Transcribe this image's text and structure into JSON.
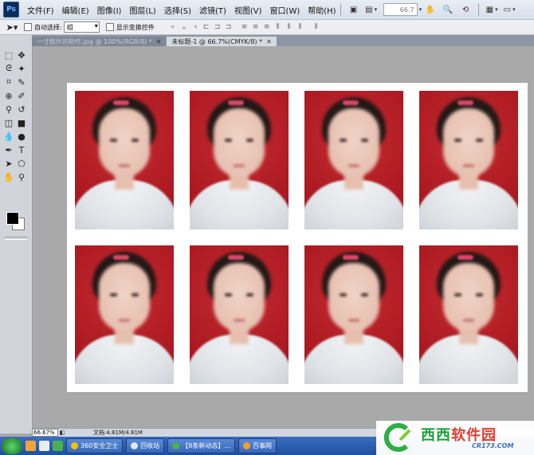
{
  "app": {
    "logo": "Ps"
  },
  "menu": [
    "文件(F)",
    "编辑(E)",
    "图像(I)",
    "图层(L)",
    "选择(S)",
    "滤镜(T)",
    "视图(V)",
    "窗口(W)",
    "帮助(H)"
  ],
  "menubar": {
    "zoom_value": "66.7"
  },
  "options": {
    "auto_select_label": "自动选择:",
    "auto_select_value": "组",
    "show_transform_label": "显示变换控件"
  },
  "tabs": [
    {
      "label": "一寸照片的制作.jpg @ 100%(RGB/8) *"
    },
    {
      "label": "未标题-1 @ 66.7%(CMYK/8) *"
    }
  ],
  "status": {
    "zoom": "66.67%",
    "doc_info": "文档:4.81M/4.81M"
  },
  "taskbar": {
    "items": [
      {
        "label": "360安全卫士",
        "color": "#f5c400"
      },
      {
        "label": "回收站",
        "color": "#dfe7f5"
      },
      {
        "label": "【8条新动态】...",
        "color": "#46b34a"
      },
      {
        "label": "百事网",
        "color": "#f2a21e"
      }
    ]
  },
  "watermark": {
    "text_green": "西西",
    "text_red": "软件园",
    "url": "CR173.COM"
  },
  "colors": {
    "photo_bg": "#b41f25",
    "canvas": "#ffffff",
    "workspace": "#a9a9a9"
  }
}
